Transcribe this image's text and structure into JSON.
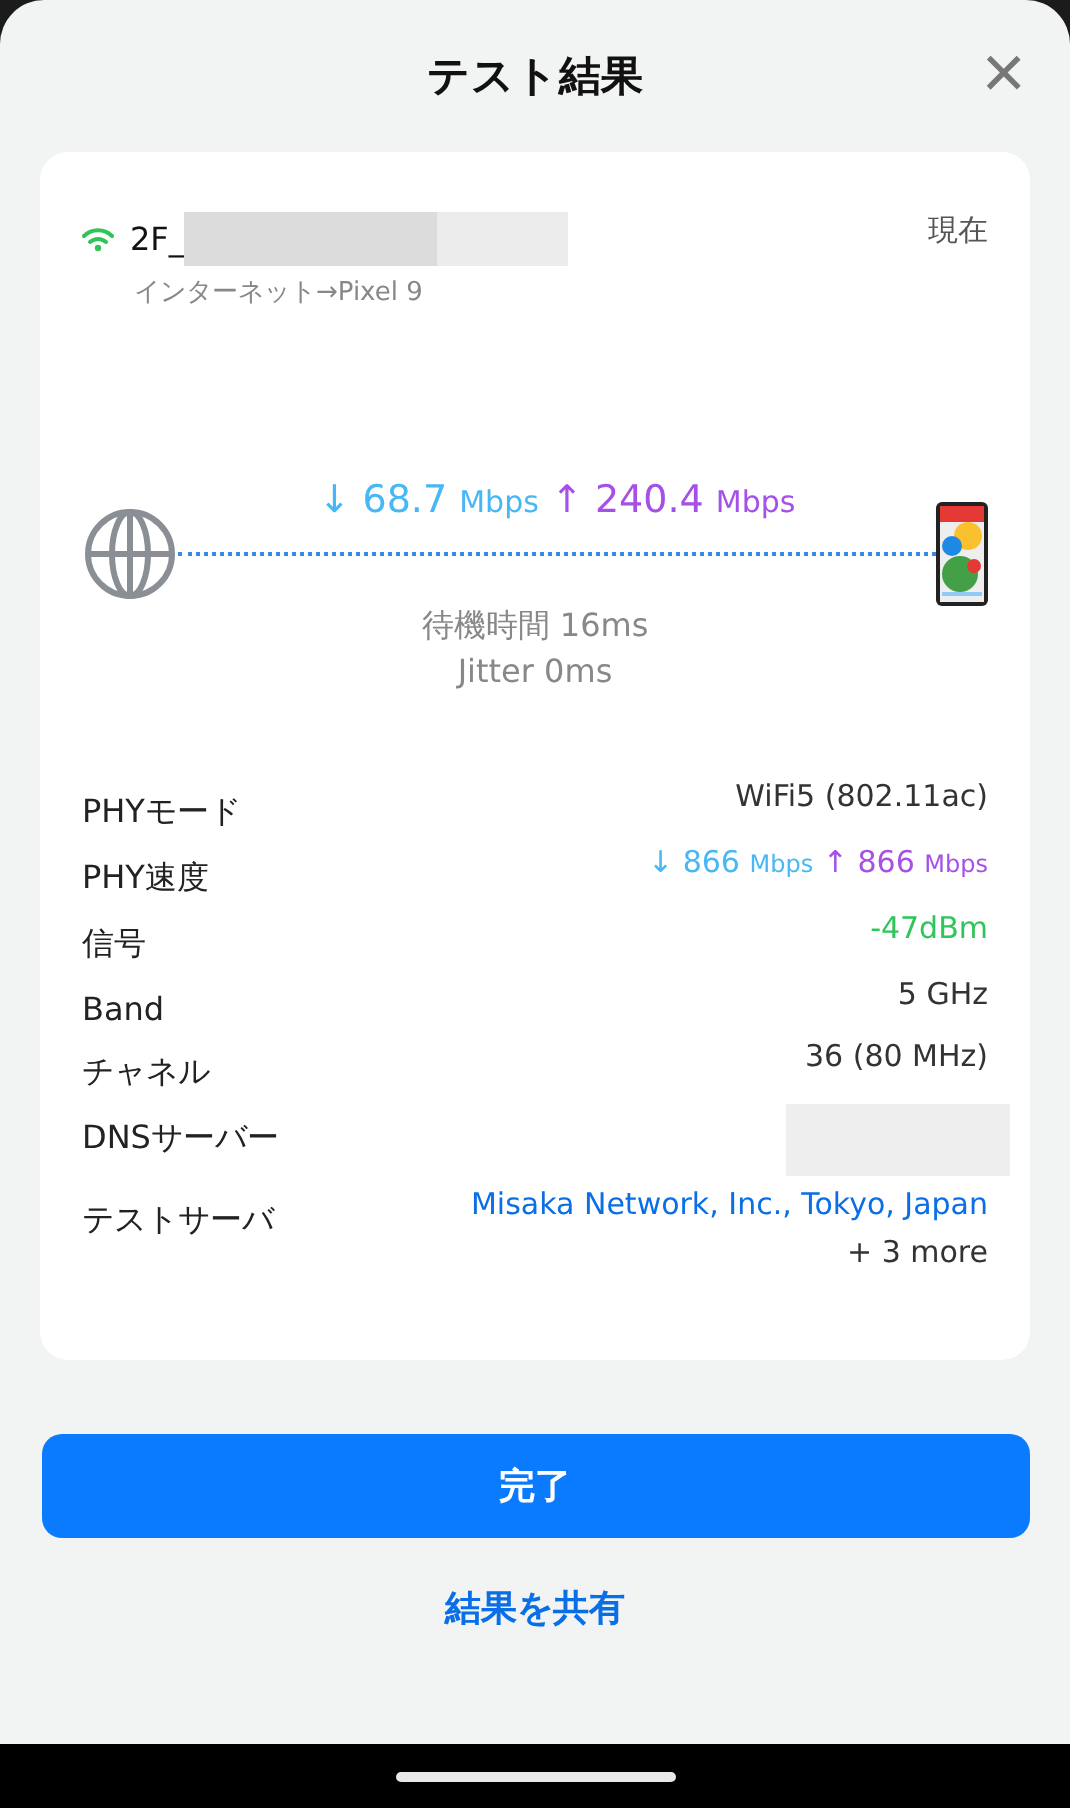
{
  "header": {
    "title": "テスト結果",
    "close": "×"
  },
  "network": {
    "name": "2F_",
    "route": "インターネット→Pixel 9",
    "time": "現在",
    "connected": true
  },
  "speed": {
    "down_arrow": "↓",
    "down": "68.7",
    "down_unit": "Mbps",
    "up_arrow": "↑",
    "up": "240.4",
    "up_unit": "Mbps",
    "latency": "待機時間 16ms",
    "jitter": "Jitter 0ms"
  },
  "details": [
    {
      "label": "PHYモード",
      "kind": "plain",
      "value": "WiFi5 (802.11ac)"
    },
    {
      "label": "PHY速度",
      "kind": "speed",
      "down_arrow": "↓",
      "down": "866",
      "down_unit": "Mbps",
      "up_arrow": "↑",
      "up": "866",
      "up_unit": "Mbps"
    },
    {
      "label": "信号",
      "kind": "signal",
      "value": "-47dBm"
    },
    {
      "label": "Band",
      "kind": "plain",
      "value": "5 GHz"
    },
    {
      "label": "チャネル",
      "kind": "plain",
      "value": "36 (80 MHz)"
    },
    {
      "label": "DNSサーバー",
      "kind": "hidden"
    },
    {
      "label": "テストサーバ",
      "kind": "link",
      "value": "Misaka Network, Inc., Tokyo, Japan",
      "extra": "+ 3 more"
    }
  ],
  "buttons": {
    "primary": "完了",
    "secondary": "結果を共有"
  }
}
